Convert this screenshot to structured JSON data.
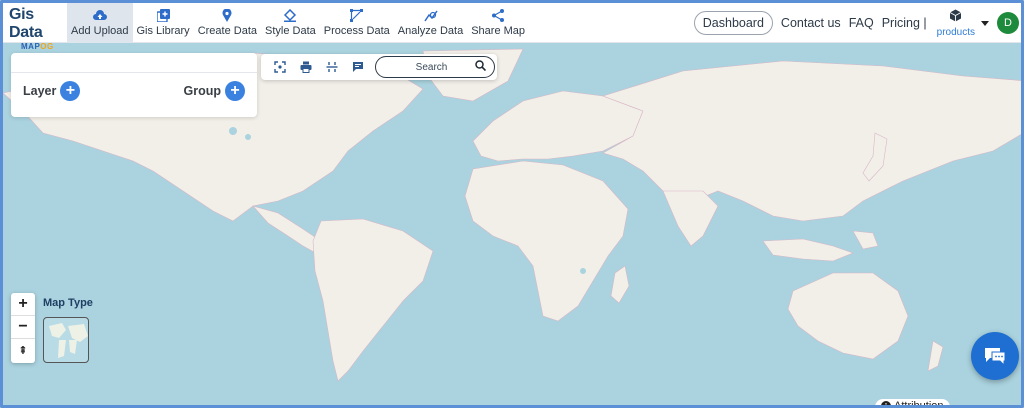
{
  "brand": {
    "line1": "Gis Data",
    "line2a": "MAP",
    "line2b": "OG"
  },
  "nav": {
    "items": [
      {
        "label": "Add Upload",
        "icon": "cloud-upload-icon",
        "active": true
      },
      {
        "label": "Gis Library",
        "icon": "library-add-icon",
        "active": false
      },
      {
        "label": "Create Data",
        "icon": "map-pin-icon",
        "active": false
      },
      {
        "label": "Style Data",
        "icon": "paint-bucket-icon",
        "active": false
      },
      {
        "label": "Process Data",
        "icon": "process-nodes-icon",
        "active": false
      },
      {
        "label": "Analyze Data",
        "icon": "analyze-icon",
        "active": false
      },
      {
        "label": "Share Map",
        "icon": "share-icon",
        "active": false
      }
    ],
    "dashboard": "Dashboard",
    "contact": "Contact us",
    "faq": "FAQ",
    "pricing": "Pricing |",
    "products": "products",
    "avatar_initial": "D"
  },
  "panel": {
    "layer_label": "Layer",
    "group_label": "Group"
  },
  "toolbar": {
    "search_placeholder": "Search"
  },
  "map": {
    "zoom_in": "+",
    "zoom_out": "−",
    "reset": "⇞",
    "map_type_label": "Map Type",
    "attribution": "Attribution"
  },
  "colors": {
    "accent": "#3b82e0",
    "ocean": "#aad3df",
    "land": "#f2efe9",
    "avatar": "#1e8a3c",
    "chat": "#1e6fd1"
  }
}
